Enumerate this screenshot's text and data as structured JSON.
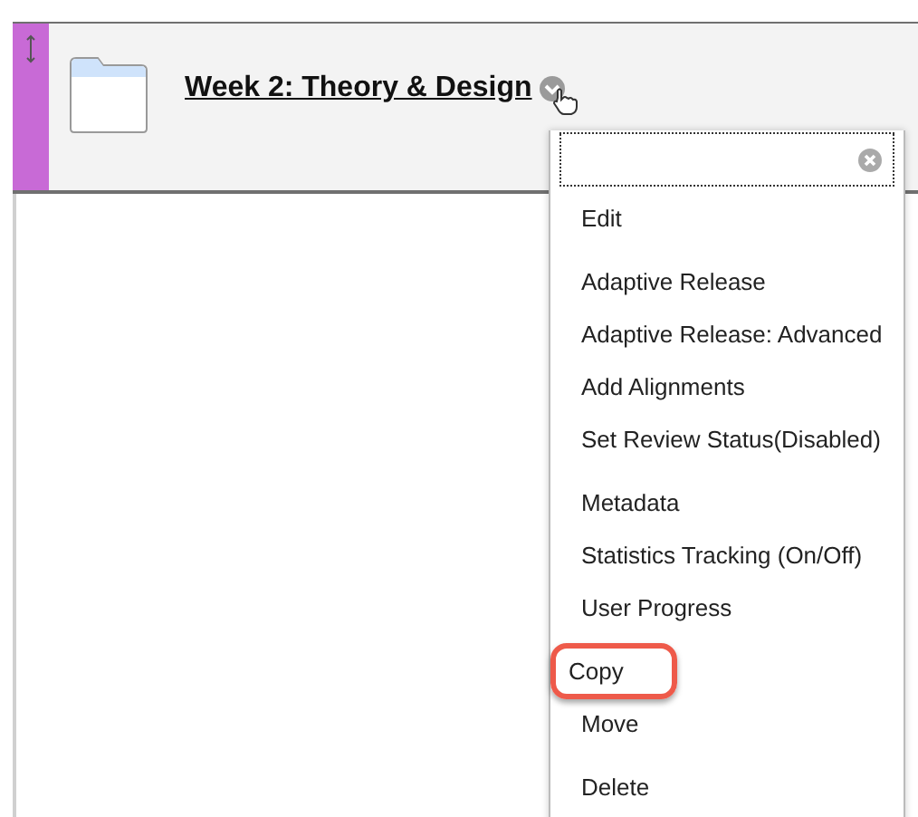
{
  "item": {
    "title": "Week 2: Theory & Design"
  },
  "menu": {
    "groups": [
      {
        "items": [
          {
            "label": "Edit",
            "highlighted": false
          }
        ]
      },
      {
        "items": [
          {
            "label": "Adaptive Release",
            "highlighted": false
          },
          {
            "label": "Adaptive Release: Advanced",
            "highlighted": false
          },
          {
            "label": "Add Alignments",
            "highlighted": false
          },
          {
            "label": "Set Review Status(Disabled)",
            "highlighted": false
          }
        ]
      },
      {
        "items": [
          {
            "label": "Metadata",
            "highlighted": false
          },
          {
            "label": "Statistics Tracking (On/Off)",
            "highlighted": false
          },
          {
            "label": "User Progress",
            "highlighted": false
          }
        ]
      },
      {
        "items": [
          {
            "label": "Copy",
            "highlighted": true
          },
          {
            "label": "Move",
            "highlighted": false
          }
        ]
      },
      {
        "items": [
          {
            "label": "Delete",
            "highlighted": false
          }
        ]
      }
    ]
  }
}
